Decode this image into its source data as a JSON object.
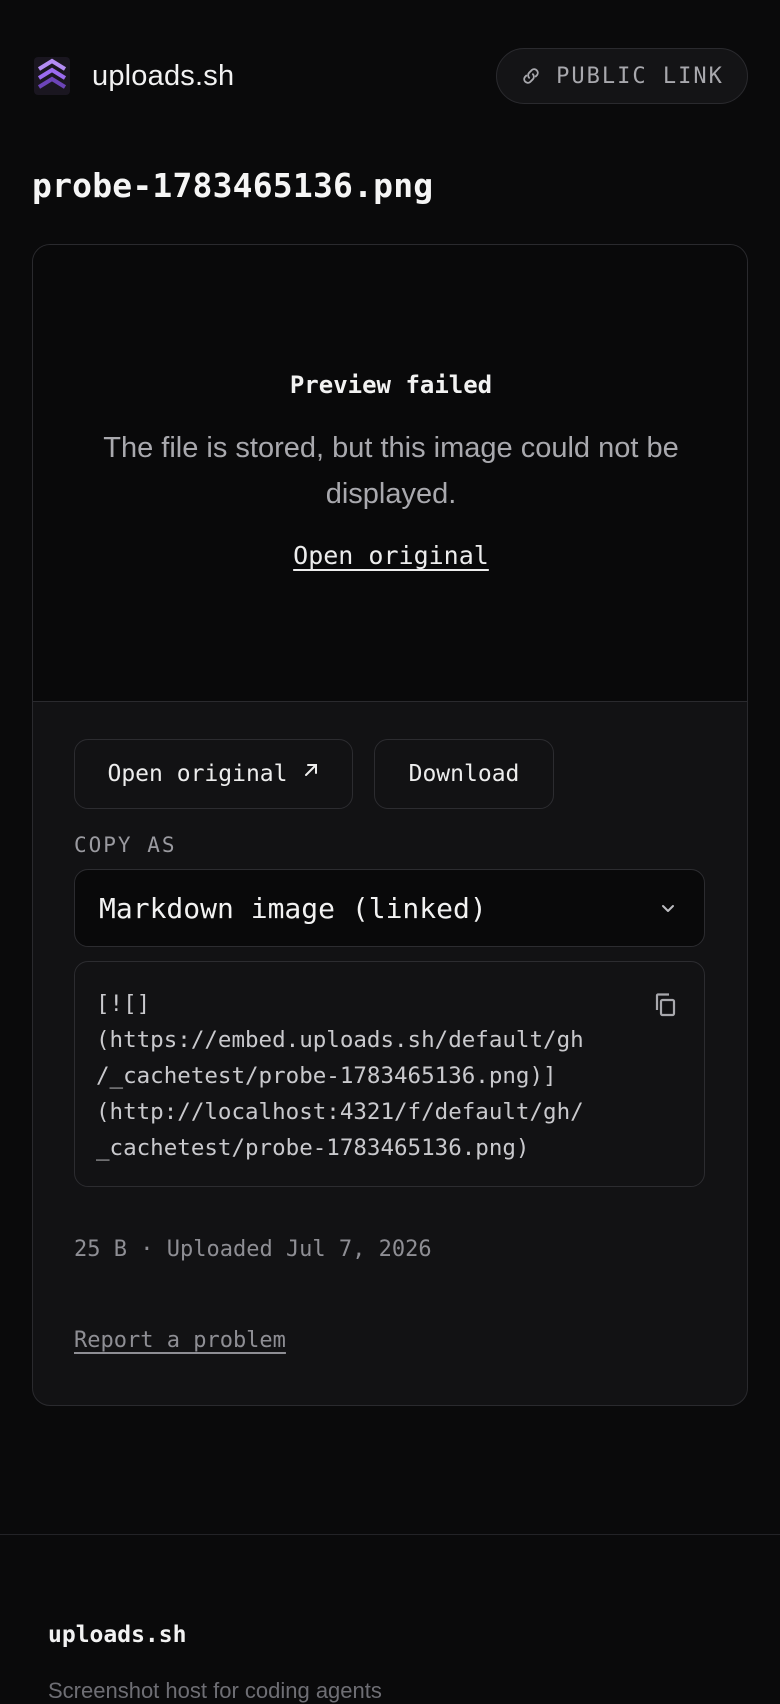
{
  "header": {
    "brand_name": "uploads.sh",
    "public_link_label": "PUBLIC LINK"
  },
  "file": {
    "name": "probe-1783465136.png"
  },
  "preview": {
    "title": "Preview failed",
    "message": "The file is stored, but this image could not be displayed.",
    "open_link": "Open original"
  },
  "actions": {
    "open_original": "Open original",
    "download": "Download"
  },
  "copy": {
    "label": "COPY AS",
    "selected_format": "Markdown image (linked)",
    "snippet": "[![]\n(https://embed.uploads.sh/default/gh\n/_cachetest/probe-1783465136.png)]\n(http://localhost:4321/f/default/gh/\n_cachetest/probe-1783465136.png)"
  },
  "meta": {
    "size": "25 B",
    "separator": "·",
    "uploaded": "Uploaded Jul 7, 2026"
  },
  "report_label": "Report a problem",
  "footer": {
    "brand": "uploads.sh",
    "tagline": "Screenshot host for coding agents"
  },
  "colors": {
    "background": "#0a0a0b",
    "card": "#121214",
    "border": "#2a2a2e",
    "logo_accent": "#9b6bf0"
  }
}
